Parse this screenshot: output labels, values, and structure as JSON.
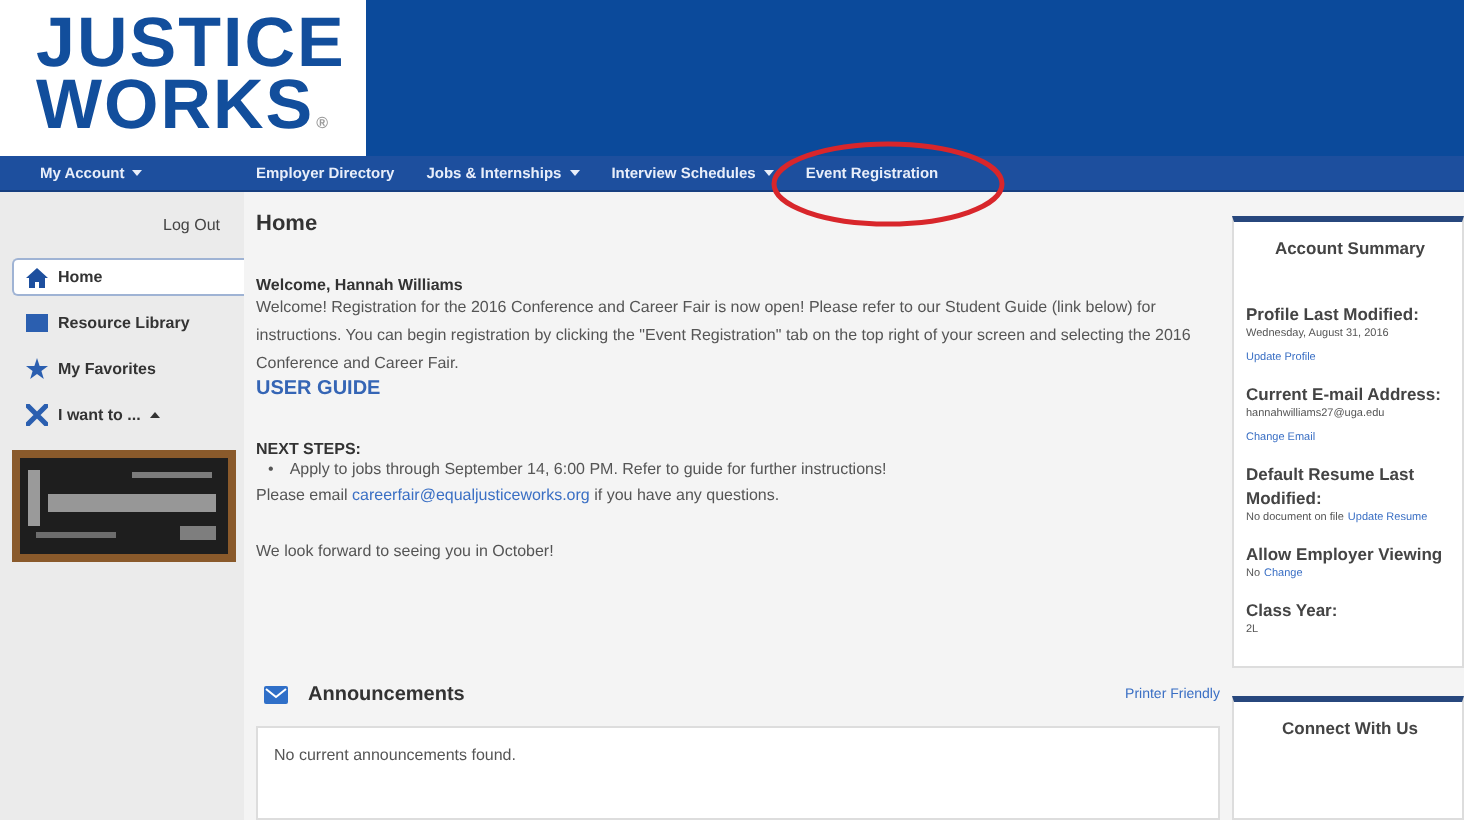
{
  "header": {
    "logo_lines": [
      "JUSTICE",
      "WORKS"
    ],
    "logo_mark": "®"
  },
  "nav": {
    "account_menu": {
      "label": "My Account",
      "has_menu": true
    },
    "items": [
      {
        "label": "Employer Directory",
        "has_menu": false,
        "circled": false
      },
      {
        "label": "Jobs & Internships",
        "has_menu": true,
        "circled": false
      },
      {
        "label": "Interview Schedules",
        "has_menu": true,
        "circled": false
      },
      {
        "label": "Event Registration",
        "has_menu": false,
        "circled": true
      }
    ]
  },
  "sidebar": {
    "logout": "Log Out",
    "items": [
      {
        "label": "Home",
        "selected": true
      },
      {
        "label": "Resource Library",
        "selected": false
      },
      {
        "label": "My Favorites",
        "selected": false
      },
      {
        "label": "I want to ...",
        "selected": false,
        "expanded": true
      }
    ]
  },
  "main": {
    "title": "Home",
    "greeting": "Welcome, Hannah Williams",
    "intro": "Welcome! Registration for the 2016 Conference and Career Fair is now open! Please refer to our Student Guide (link below) for instructions. You can begin registration by clicking the \"Event Registration\" tab on the top right of your screen and selecting the 2016 Conference and Career Fair.",
    "guide_link": "USER GUIDE",
    "next_steps_title": "NEXT STEPS:",
    "bullet": "•",
    "next_steps": [
      "Apply to jobs through September 14, 6:00 PM. Refer to guide for further instructions!"
    ],
    "contact": {
      "before": "Please email ",
      "link": "careerfair@equaljusticeworks.org",
      "after": " if you have any questions."
    },
    "closing": "We look forward to seeing you in October!"
  },
  "announcements": {
    "title": "Announcements",
    "printer_link": "Printer Friendly",
    "empty_text": "No current announcements found."
  },
  "account_summary": {
    "title": "Account Summary",
    "sections": [
      {
        "label": "Profile Last Modified:",
        "value": "Wednesday, August 31, 2016",
        "link": "Update Profile",
        "kind": "stacked"
      },
      {
        "label": "Current E-mail Address:",
        "value": "hannahwilliams27@uga.edu",
        "link": "Change Email",
        "kind": "stacked"
      },
      {
        "label": "Default Resume Last Modified:",
        "value": "No document on file",
        "link": "Update Resume",
        "kind": "inline"
      },
      {
        "label": "Allow Employer Viewing",
        "value": "No",
        "link": "Change",
        "kind": "inline"
      },
      {
        "label": "Class Year:",
        "value": "2L",
        "kind": "plain"
      }
    ]
  },
  "connect": {
    "title": "Connect With Us"
  }
}
